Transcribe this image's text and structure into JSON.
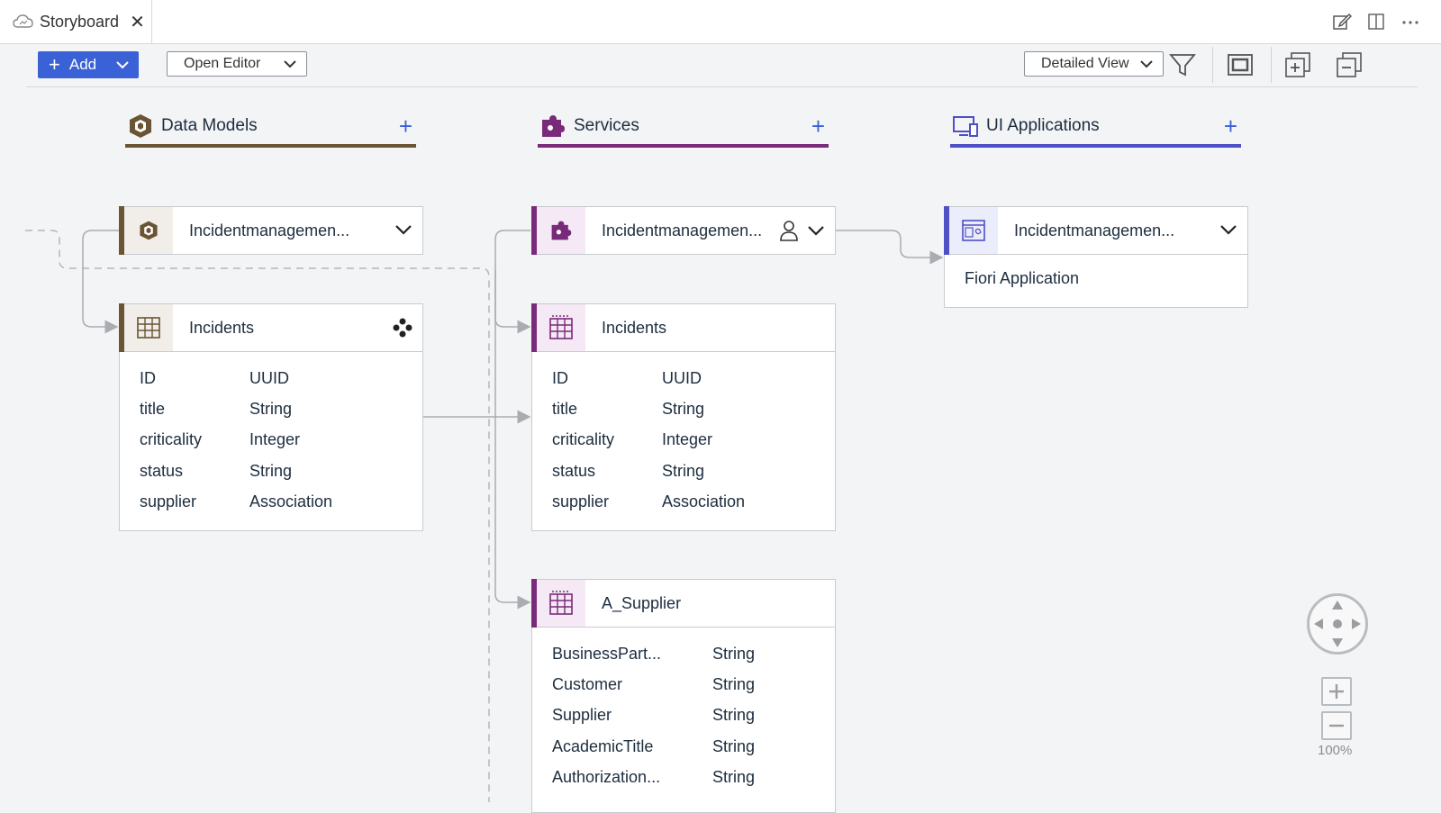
{
  "tab": {
    "label": "Storyboard",
    "close": "✕"
  },
  "toolbar": {
    "add_label": "Add",
    "open_editor_label": "Open Editor",
    "view_label": "Detailed View"
  },
  "columns": [
    {
      "title": "Data Models",
      "color": "#6b5434"
    },
    {
      "title": "Services",
      "color": "#7a2a7a"
    },
    {
      "title": "UI Applications",
      "color": "#4f4fc6"
    }
  ],
  "cards": {
    "dm_project": {
      "title": "Incidentmanagemen..."
    },
    "dm_incidents": {
      "title": "Incidents",
      "fields": [
        {
          "name": "ID",
          "type": "UUID"
        },
        {
          "name": "title",
          "type": "String"
        },
        {
          "name": "criticality",
          "type": "Integer"
        },
        {
          "name": "status",
          "type": "String"
        },
        {
          "name": "supplier",
          "type": "Association"
        }
      ]
    },
    "svc_project": {
      "title": "Incidentmanagemen..."
    },
    "svc_incidents": {
      "title": "Incidents",
      "fields": [
        {
          "name": "ID",
          "type": "UUID"
        },
        {
          "name": "title",
          "type": "String"
        },
        {
          "name": "criticality",
          "type": "Integer"
        },
        {
          "name": "status",
          "type": "String"
        },
        {
          "name": "supplier",
          "type": "Association"
        }
      ]
    },
    "svc_supplier": {
      "title": "A_Supplier",
      "fields": [
        {
          "name": "BusinessPart...",
          "type": "String"
        },
        {
          "name": "Customer",
          "type": "String"
        },
        {
          "name": "Supplier",
          "type": "String"
        },
        {
          "name": "AcademicTitle",
          "type": "String"
        },
        {
          "name": "Authorization...",
          "type": "String"
        }
      ]
    },
    "ui_app": {
      "title": "Incidentmanagemen...",
      "subtitle": "Fiori Application"
    }
  },
  "zoom": {
    "level": "100%"
  },
  "icons": {
    "cloud": "cloud-icon",
    "close": "close-icon",
    "edit": "edit-icon",
    "split": "split-view-icon",
    "more": "more-icon",
    "filter": "filter-icon",
    "fit": "fit-to-screen-icon",
    "expand": "expand-all-icon",
    "collapse": "collapse-all-icon"
  }
}
